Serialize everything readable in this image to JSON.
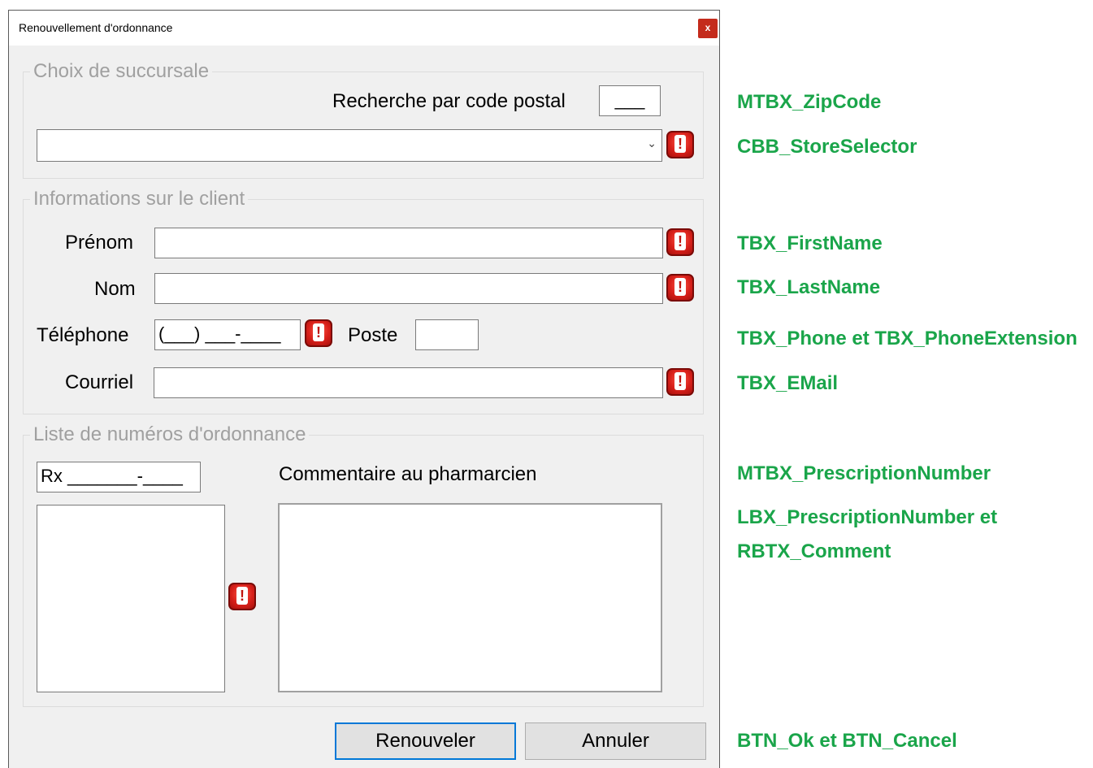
{
  "window": {
    "title": "Renouvellement d'ordonnance",
    "close_label": "x"
  },
  "store_group": {
    "legend": "Choix de succursale",
    "zip_label": "Recherche par code postal",
    "zip_value": "___",
    "store_value": ""
  },
  "client_group": {
    "legend": "Informations sur le client",
    "first_name_label": "Prénom",
    "last_name_label": "Nom",
    "phone_label": "Téléphone",
    "phone_value": "(___) ___-____",
    "extension_label": "Poste",
    "email_label": "Courriel"
  },
  "rx_group": {
    "legend": "Liste de numéros d'ordonnance",
    "rx_value": "Rx _______-____",
    "comment_label": "Commentaire au pharmarcien"
  },
  "buttons": {
    "ok_label": "Renouveler",
    "cancel_label": "Annuler"
  },
  "annotations": {
    "zip": "MTBX_ZipCode",
    "store": "CBB_StoreSelector",
    "first_name": "TBX_FirstName",
    "last_name": "TBX_LastName",
    "phone": "TBX_Phone et TBX_PhoneExtension",
    "email": "TBX_EMail",
    "rx_number": "MTBX_PrescriptionNumber",
    "list_line1": "LBX_PrescriptionNumber et",
    "list_line2": "RBTX_Comment",
    "buttons": "BTN_Ok et BTN_Cancel"
  },
  "icons": {
    "error": "error-exclamation-icon",
    "dropdown": "chevron-down-icon",
    "close": "close-icon"
  },
  "colors": {
    "annotation": "#1aa54a",
    "error": "#d8201a",
    "close": "#c42b1c",
    "default_button_border": "#0078d7"
  }
}
